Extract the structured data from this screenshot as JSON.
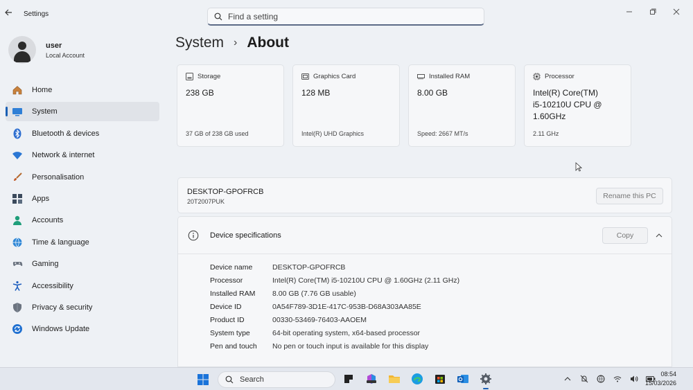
{
  "window": {
    "app_title": "Settings",
    "search_placeholder": "Find a setting"
  },
  "user": {
    "name": "user",
    "account_type": "Local Account"
  },
  "sidebar": {
    "items": [
      {
        "label": "Home",
        "icon": "home-icon"
      },
      {
        "label": "System",
        "icon": "system-icon",
        "active": true
      },
      {
        "label": "Bluetooth & devices",
        "icon": "bluetooth-icon"
      },
      {
        "label": "Network & internet",
        "icon": "wifi-icon"
      },
      {
        "label": "Personalisation",
        "icon": "brush-icon"
      },
      {
        "label": "Apps",
        "icon": "apps-icon"
      },
      {
        "label": "Accounts",
        "icon": "accounts-icon"
      },
      {
        "label": "Time & language",
        "icon": "globe-clock-icon"
      },
      {
        "label": "Gaming",
        "icon": "gamepad-icon"
      },
      {
        "label": "Accessibility",
        "icon": "accessibility-icon"
      },
      {
        "label": "Privacy & security",
        "icon": "shield-icon"
      },
      {
        "label": "Windows Update",
        "icon": "update-icon"
      }
    ]
  },
  "breadcrumb": {
    "parent": "System",
    "separator": "›",
    "current": "About"
  },
  "cards": [
    {
      "label": "Storage",
      "value": "238 GB",
      "detail": "37 GB of 238 GB used",
      "icon": "storage-icon"
    },
    {
      "label": "Graphics Card",
      "value": "128 MB",
      "detail": "Intel(R) UHD Graphics",
      "icon": "gpu-icon"
    },
    {
      "label": "Installed RAM",
      "value": "8.00 GB",
      "detail": "Speed: 2667 MT/s",
      "icon": "ram-icon"
    },
    {
      "label": "Processor",
      "value": "Intel(R) Core(TM) i5-10210U CPU @ 1.60GHz",
      "detail": "2.11 GHz",
      "icon": "processor-icon"
    }
  ],
  "pc": {
    "name": "DESKTOP-GPOFRCB",
    "model": "20T2007PUK",
    "rename_label": "Rename this PC"
  },
  "specs": {
    "title": "Device specifications",
    "copy_label": "Copy",
    "rows": [
      {
        "label": "Device name",
        "value": "DESKTOP-GPOFRCB"
      },
      {
        "label": "Processor",
        "value": "Intel(R) Core(TM) i5-10210U CPU @ 1.60GHz (2.11 GHz)"
      },
      {
        "label": "Installed RAM",
        "value": "8.00 GB (7.76 GB usable)"
      },
      {
        "label": "Device ID",
        "value": "0A54F789-3D1E-417C-953B-D68A303AA85E"
      },
      {
        "label": "Product ID",
        "value": "00330-53469-76403-AAOEM"
      },
      {
        "label": "System type",
        "value": "64-bit operating system, x64-based processor"
      },
      {
        "label": "Pen and touch",
        "value": "No pen or touch input is available for this display"
      }
    ]
  },
  "taskbar": {
    "search_label": "Search",
    "time": "08:54",
    "date": "15/03/2026"
  },
  "colors": {
    "accent": "#1a5fb4",
    "background": "#eef1f5",
    "card": "#f6f7f9"
  }
}
